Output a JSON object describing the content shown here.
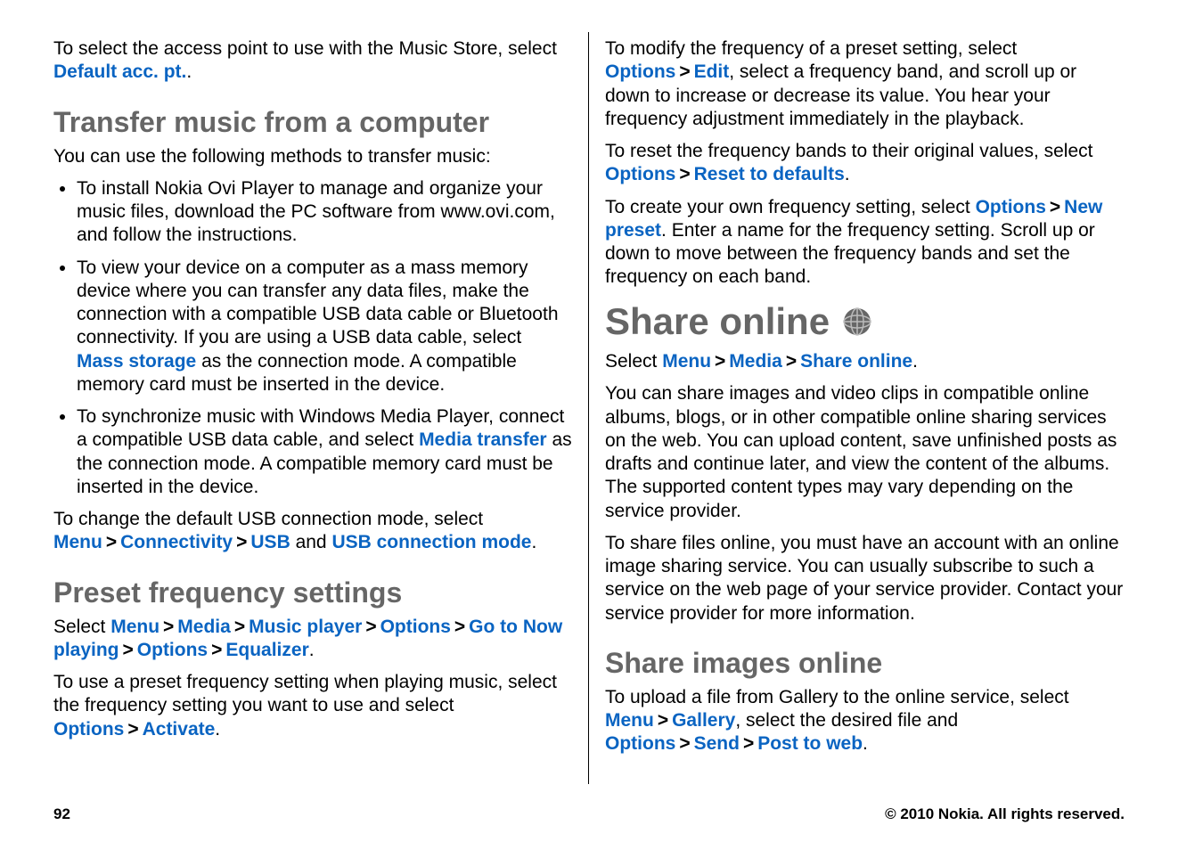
{
  "left": {
    "intro_text_a": "To select the access point to use with the Music Store, select ",
    "intro_link": "Default acc. pt.",
    "intro_text_b": ".",
    "h_transfer": "Transfer music from a computer",
    "transfer_intro": "You can use the following methods to transfer music:",
    "bullet1": "To install Nokia Ovi Player to manage and organize your music files, download the PC software from www.ovi.com, and follow the instructions.",
    "bullet2_a": "To view your device on a computer as a mass memory device where you can transfer any data files, make the connection with a compatible USB data cable or Bluetooth connectivity. If you are using a USB data cable, select ",
    "bullet2_link": "Mass storage",
    "bullet2_b": " as the connection mode. A compatible memory card must be inserted in the device.",
    "bullet3_a": "To synchronize music with Windows Media Player, connect a compatible USB data cable, and select ",
    "bullet3_link": "Media transfer",
    "bullet3_b": " as the connection mode. A compatible memory card must be inserted in the device.",
    "usb_a": "To change the default USB connection mode, select ",
    "l_menu": "Menu",
    "l_connectivity": "Connectivity",
    "l_usb": "USB",
    "usb_and": " and ",
    "l_usb_mode": "USB connection mode",
    "usb_end": ".",
    "h_preset": "Preset frequency settings",
    "preset_a": "Select ",
    "l_media": "Media",
    "l_musicplayer": "Music player",
    "l_options": "Options",
    "l_goto": "Go to Now playing",
    "l_equalizer": "Equalizer",
    "preset_end": ".",
    "preset2_a": "To use a preset frequency setting when playing music, select the frequency setting you want to use and select ",
    "l_activate": "Activate",
    "preset2_end": "."
  },
  "right": {
    "mod_a": "To modify the frequency of a preset setting, select ",
    "l_options": "Options",
    "l_edit": "Edit",
    "mod_b": ", select a frequency band, and scroll up or down to increase or decrease its value. You hear your frequency adjustment immediately in the playback.",
    "reset_a": "To reset the frequency bands to their original values, select ",
    "l_reset": "Reset to defaults",
    "reset_end": ".",
    "new_a": "To create your own frequency setting, select ",
    "l_newpreset": "New preset",
    "new_b": ". Enter a name for the frequency setting. Scroll up or down to move between the frequency bands and set the frequency on each band.",
    "h_share": "Share online",
    "share_select_a": "Select ",
    "l_menu": "Menu",
    "l_media": "Media",
    "l_shareonline": "Share online",
    "share_select_end": ".",
    "share_p1": "You can share images and video clips in compatible online albums, blogs, or in other compatible online sharing services on the web. You can upload content, save unfinished posts as drafts and continue later, and view the content of the albums. The supported content types may vary depending on the service provider.",
    "share_p2": "To share files online, you must have an account with an online image sharing service. You can usually subscribe to such a service on the web page of your service provider. Contact your service provider for more information.",
    "h_share_images": "Share images online",
    "img_a": "To upload a file from Gallery to the online service, select ",
    "l_gallery": "Gallery",
    "img_b": ", select the desired file and ",
    "l_send": "Send",
    "l_posttoweb": "Post to web",
    "img_end": "."
  },
  "footer": {
    "page": "92",
    "copyright": "© 2010 Nokia. All rights reserved."
  },
  "gt": ">"
}
